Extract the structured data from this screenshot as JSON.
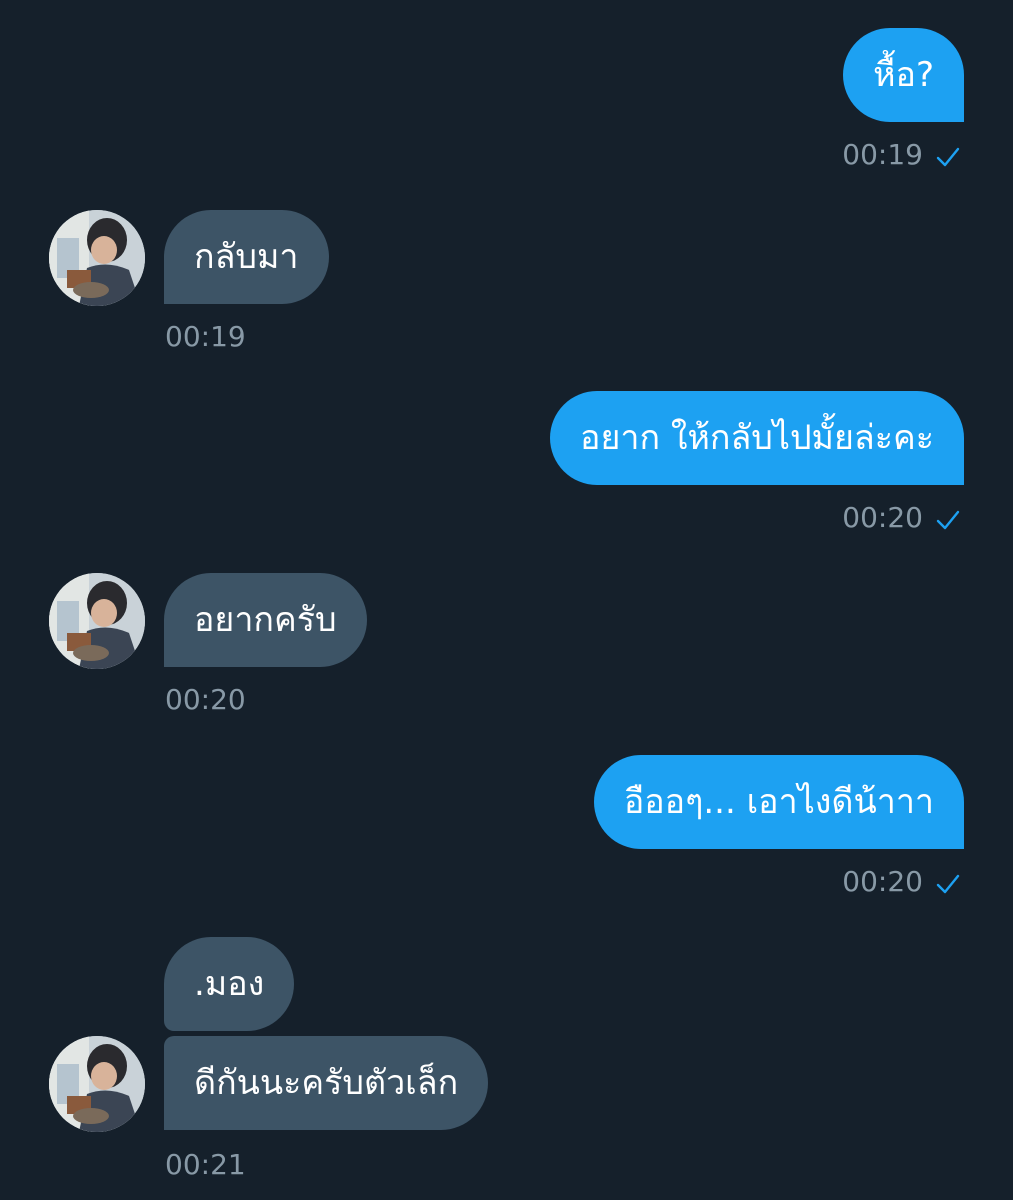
{
  "colors": {
    "background": "#15202b",
    "outgoing_bubble": "#1da1f2",
    "incoming_bubble": "#3d5466",
    "timestamp": "#8899a6",
    "read_check": "#1da1f2"
  },
  "messages": [
    {
      "direction": "outgoing",
      "text": "หื้อ?",
      "time": "00:19",
      "read_icon": "check-icon"
    },
    {
      "direction": "incoming",
      "text": "กลับมา",
      "time": "00:19",
      "avatar_icon": "user-avatar"
    },
    {
      "direction": "outgoing",
      "text": "อยาก ให้กลับไปมั้ยล่ะคะ",
      "time": "00:20",
      "read_icon": "check-icon"
    },
    {
      "direction": "incoming",
      "text": "อยากครับ",
      "time": "00:20",
      "avatar_icon": "user-avatar"
    },
    {
      "direction": "outgoing",
      "text": "อืออๆ... เอาไงดีน้าาา",
      "time": "00:20",
      "read_icon": "check-icon"
    },
    {
      "direction": "incoming",
      "text": ".มอง",
      "time": "",
      "avatar_icon": ""
    },
    {
      "direction": "incoming",
      "text": "ดีกันนะครับตัวเล็ก",
      "time": "00:21",
      "avatar_icon": "user-avatar"
    }
  ]
}
